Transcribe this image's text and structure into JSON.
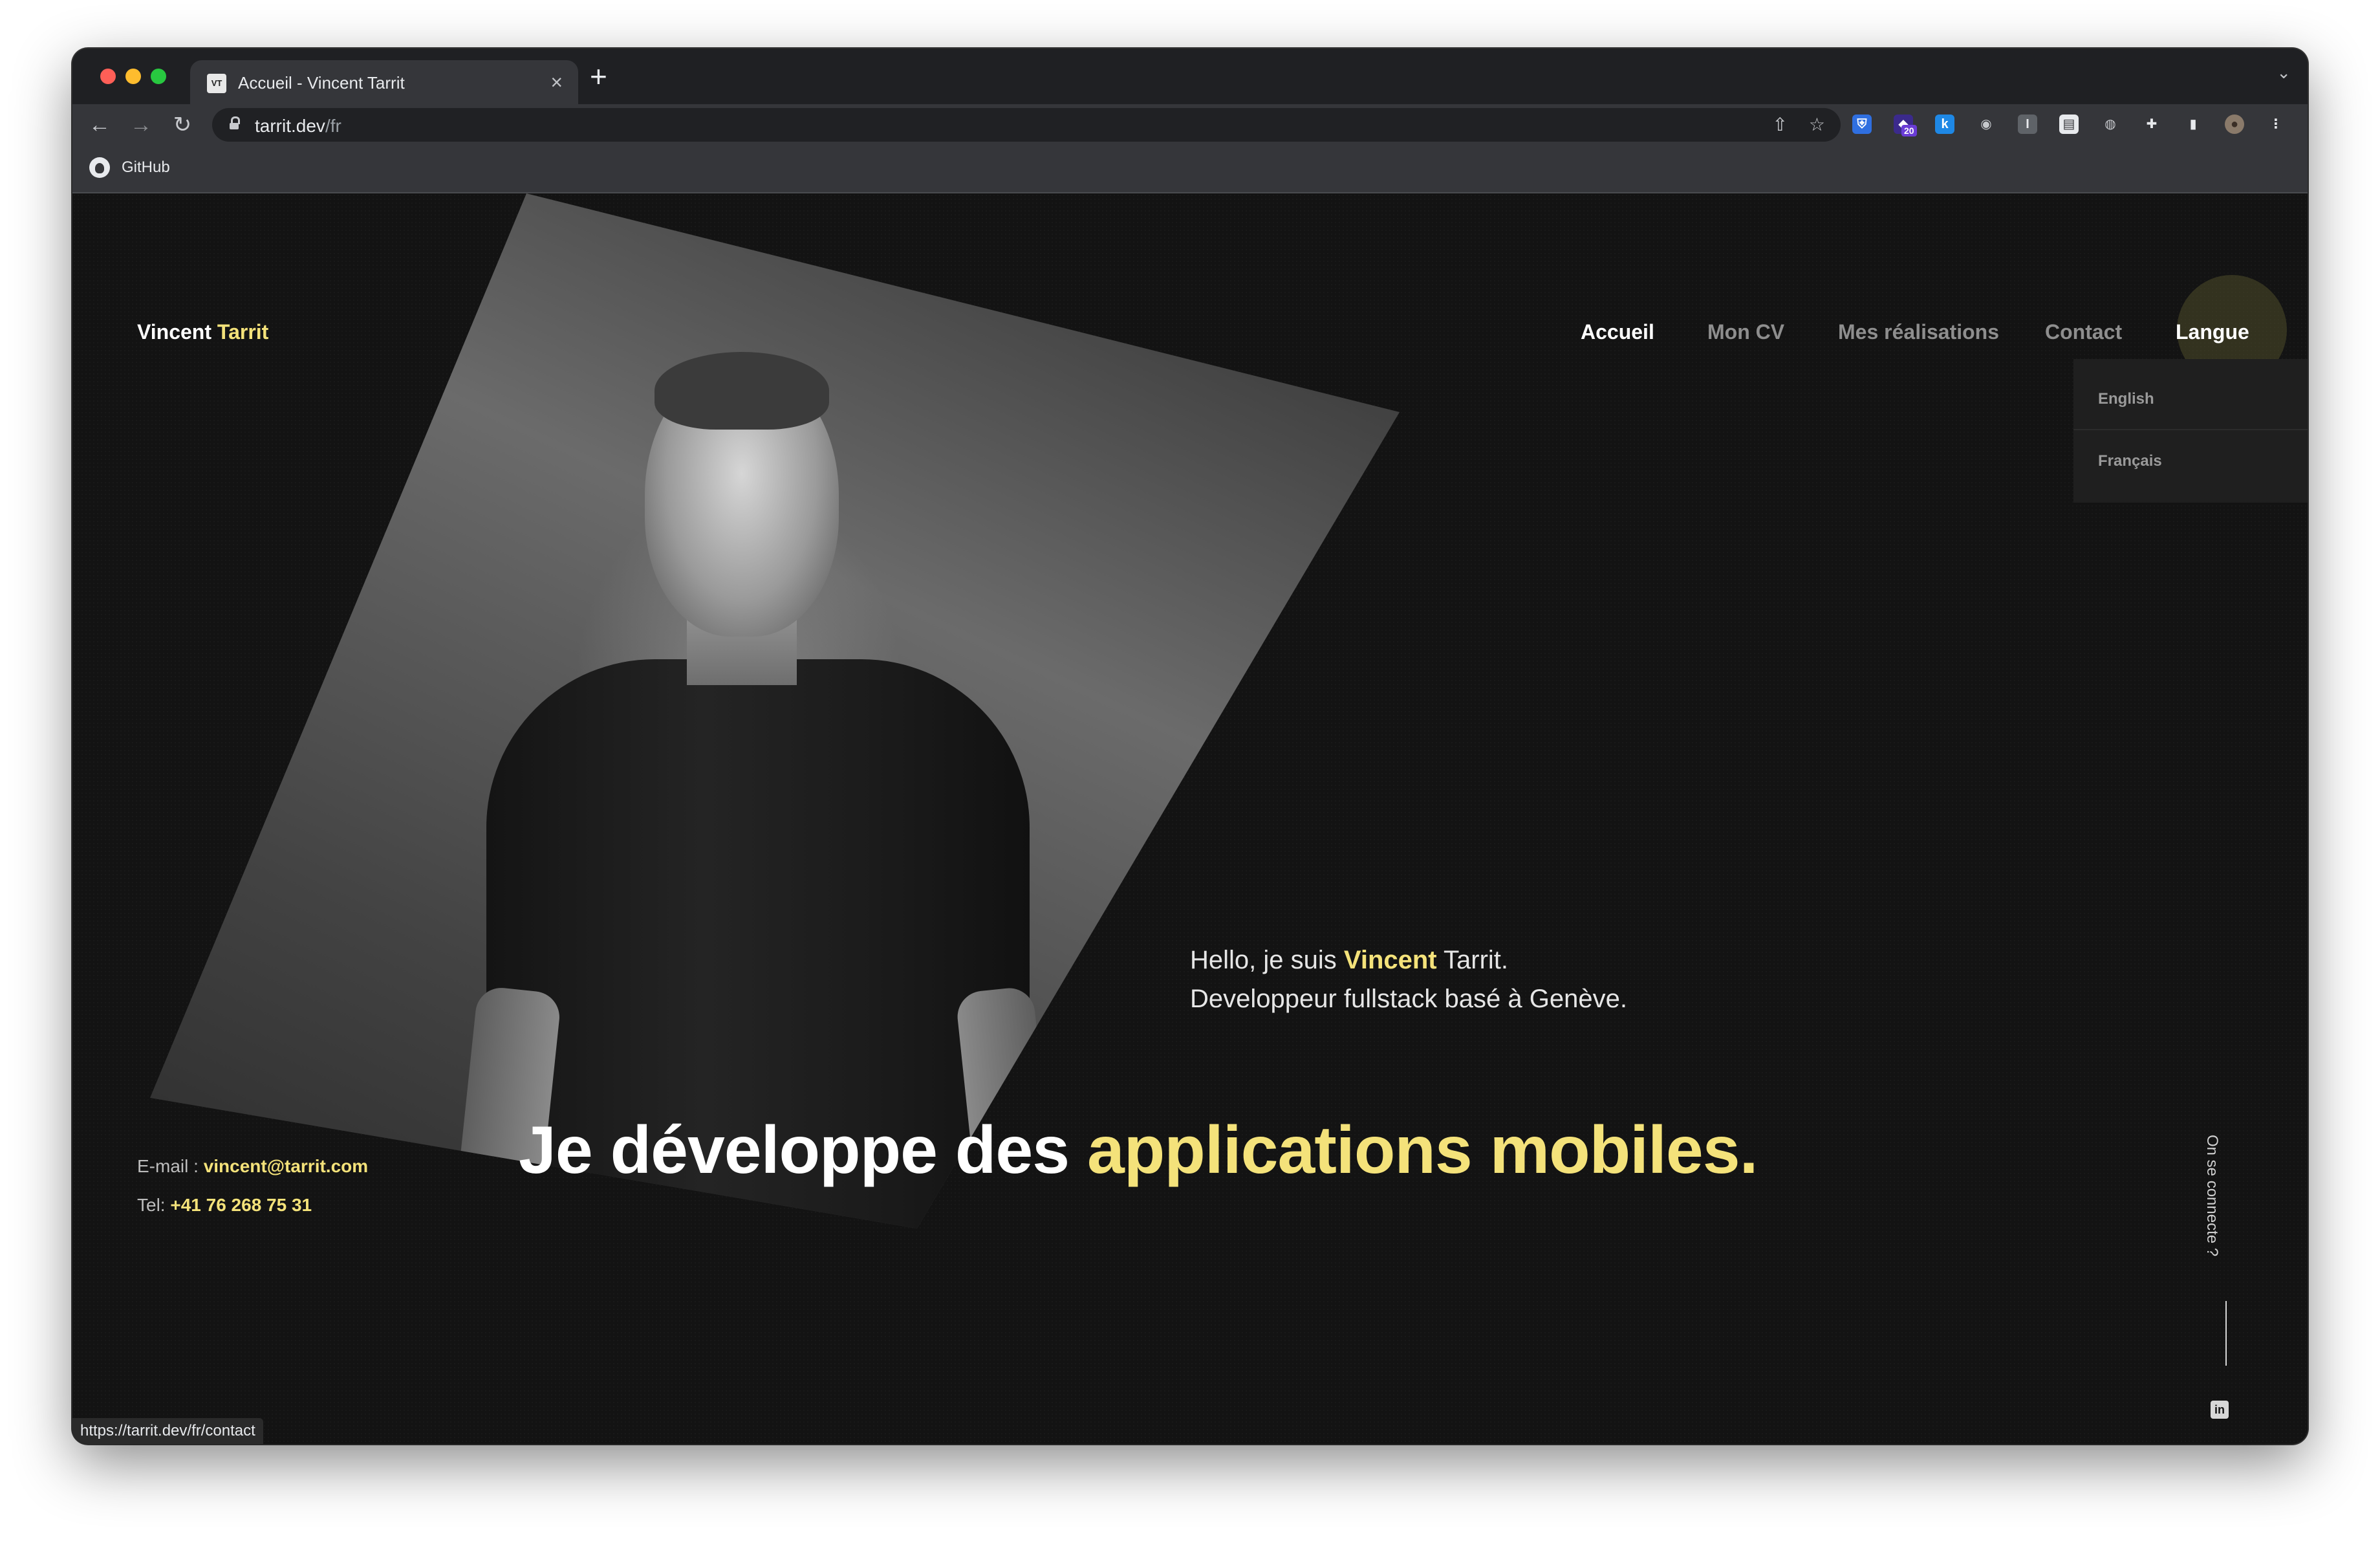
{
  "browser": {
    "tab": {
      "favicon_text": "VT",
      "title": "Accueil - Vincent Tarrit",
      "close": "×"
    },
    "new_tab": "+",
    "tabs_menu": "⌄",
    "toolbar": {
      "back": "←",
      "forward": "→",
      "reload": "↻"
    },
    "address": {
      "host": "tarrit.dev",
      "path": "/fr"
    },
    "address_actions": {
      "share": "⇧",
      "bookmark": "☆"
    },
    "extensions": [
      {
        "name": "bitwarden-icon",
        "glyph": "⛨",
        "badge": "",
        "bg": "#2f6fe0",
        "fg": "#ffffff"
      },
      {
        "name": "counter-extension-icon",
        "glyph": "◆",
        "badge": "20",
        "bg": "#3b2a8c",
        "fg": "#ffffff"
      },
      {
        "name": "k-extension-icon",
        "glyph": "k",
        "badge": "",
        "bg": "#1e88e5",
        "fg": "#ffffff"
      },
      {
        "name": "camera-icon",
        "glyph": "◉",
        "badge": "",
        "bg": "transparent",
        "fg": "#c7c9cd"
      },
      {
        "name": "i-extension-icon",
        "glyph": "I",
        "badge": "",
        "bg": "#5f6368",
        "fg": "#e8eaed"
      },
      {
        "name": "document-extension-icon",
        "glyph": "▤",
        "badge": "",
        "bg": "#e8eaed",
        "fg": "#35363a"
      },
      {
        "name": "globe-extension-icon",
        "glyph": "◍",
        "badge": "",
        "bg": "transparent",
        "fg": "#c7c9cd"
      },
      {
        "name": "puzzle-icon",
        "glyph": "✚",
        "badge": "",
        "bg": "transparent",
        "fg": "#e8eaed"
      },
      {
        "name": "side-panel-icon",
        "glyph": "▮",
        "badge": "",
        "bg": "transparent",
        "fg": "#e8eaed"
      },
      {
        "name": "profile-avatar",
        "glyph": "●",
        "badge": "",
        "bg": "#8a7a6a",
        "fg": "#3a2e26"
      },
      {
        "name": "kebab-menu-icon",
        "glyph": "⋮",
        "badge": "",
        "bg": "transparent",
        "fg": "#e8eaed"
      }
    ],
    "bookmarks": [
      {
        "label": "GitHub"
      }
    ],
    "status_url": "https://tarrit.dev/fr/contact"
  },
  "site": {
    "name_first": "Vincent",
    "name_last": "Tarrit",
    "nav": [
      {
        "label": "Accueil",
        "active": true
      },
      {
        "label": "Mon CV",
        "active": false
      },
      {
        "label": "Mes réalisations",
        "active": false
      },
      {
        "label": "Contact",
        "active": false
      },
      {
        "label": "Langue",
        "active": true
      }
    ],
    "language_menu": [
      {
        "label": "English"
      },
      {
        "label": "Français"
      }
    ],
    "intro": {
      "prefix": "Hello, je suis ",
      "highlight": "Vincent",
      "suffix": " Tarrit.",
      "line2": "Developpeur fullstack basé à Genève."
    },
    "headline": {
      "prefix": "Je développe des ",
      "highlight": "applications mobiles."
    },
    "contact": {
      "email_label": "E-mail : ",
      "email": "vincent@tarrit.com",
      "tel_label": "Tel: ",
      "tel": "+41 76 268 75 31"
    },
    "social": {
      "title": "On se connecte ?",
      "linkedin_glyph": "in"
    }
  },
  "colors": {
    "accent": "#f4e27a",
    "page_background": "#131313",
    "nav_inactive": "#8e8e8e",
    "dropdown_background": "#1f1f1f"
  }
}
